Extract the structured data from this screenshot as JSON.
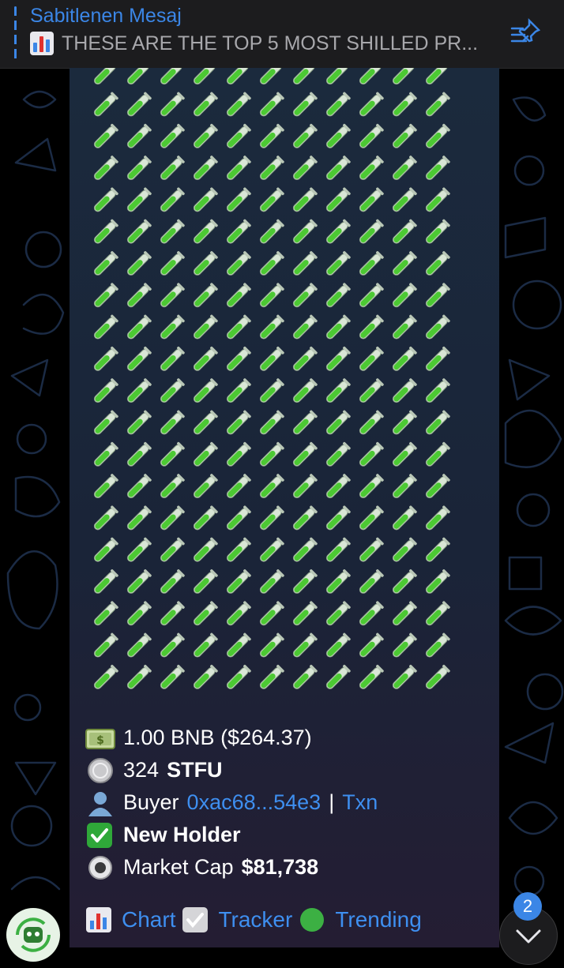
{
  "pinned": {
    "title": "Sabitlenen Mesaj",
    "text": "THESE ARE THE TOP 5 MOST SHILLED PR...",
    "icon": "pin-list-icon"
  },
  "message": {
    "tube_icon": "test-tube-icon",
    "tube_rows": 20,
    "tube_cols": 11,
    "amount": "1.00 BNB ($264.37)",
    "token_count": "324",
    "token_symbol": "STFU",
    "buyer_label": "Buyer",
    "buyer_address": "0xac68...54e3",
    "separator": "|",
    "txn_label": "Txn",
    "new_holder": "New Holder",
    "market_cap_label": "Market Cap",
    "market_cap_value": "$81,738",
    "buttons": {
      "chart": "Chart",
      "tracker": "Tracker",
      "trending": "Trending"
    }
  },
  "scroll_down": {
    "unread_count": "2"
  },
  "colors": {
    "accent": "#3b86e6",
    "link": "#3e8ff0",
    "tube_green": "#4cc933",
    "check_green": "#2fa839"
  }
}
